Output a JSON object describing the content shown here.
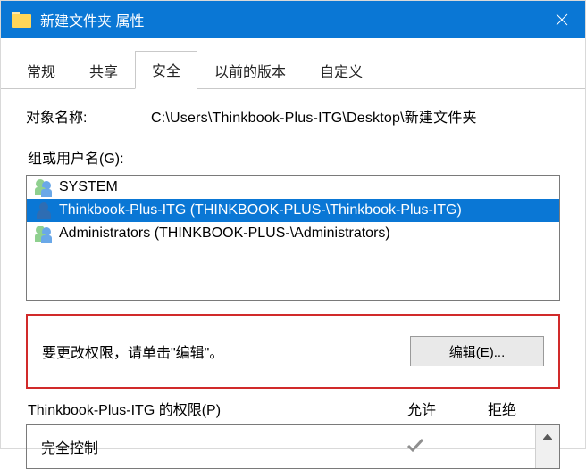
{
  "titlebar": {
    "title": "新建文件夹 属性"
  },
  "tabs": {
    "items": [
      {
        "label": "常规"
      },
      {
        "label": "共享"
      },
      {
        "label": "安全"
      },
      {
        "label": "以前的版本"
      },
      {
        "label": "自定义"
      }
    ],
    "active_index": 2
  },
  "object": {
    "label": "对象名称:",
    "path": "C:\\Users\\Thinkbook-Plus-ITG\\Desktop\\新建文件夹"
  },
  "groups": {
    "label": "组或用户名(G):",
    "items": [
      {
        "icon": "group",
        "text": "SYSTEM",
        "selected": false
      },
      {
        "icon": "user",
        "text": "Thinkbook-Plus-ITG (THINKBOOK-PLUS-\\Thinkbook-Plus-ITG)",
        "selected": true
      },
      {
        "icon": "group",
        "text": "Administrators (THINKBOOK-PLUS-\\Administrators)",
        "selected": false
      }
    ]
  },
  "edit": {
    "hint": "要更改权限，请单击\"编辑\"。",
    "button": "编辑(E)..."
  },
  "perm": {
    "header": "Thinkbook-Plus-ITG 的权限(P)",
    "allow": "允许",
    "deny": "拒绝",
    "rows": [
      {
        "name": "完全控制",
        "allow": true,
        "deny": false
      }
    ]
  }
}
